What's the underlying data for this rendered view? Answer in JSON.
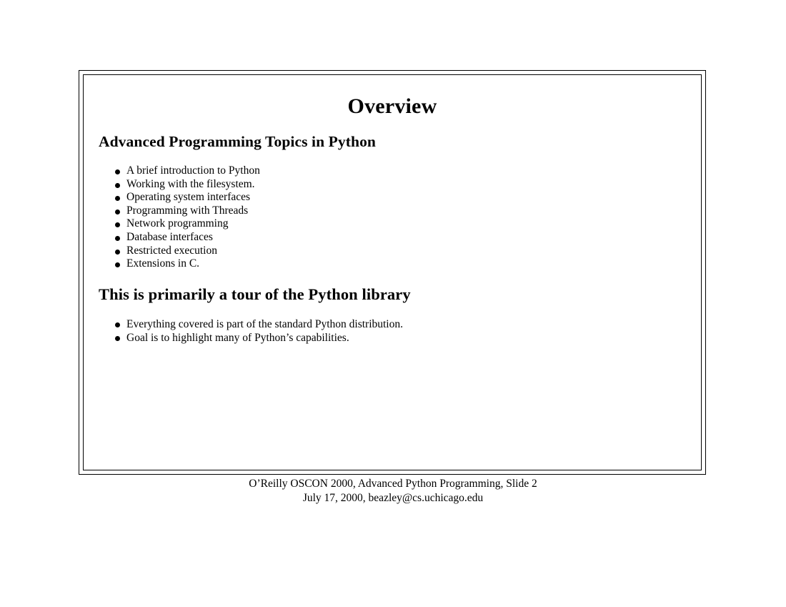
{
  "slide": {
    "title": "Overview",
    "sections": [
      {
        "heading": "Advanced Programming Topics in Python",
        "bullets": [
          "A brief introduction to Python",
          "Working with the filesystem.",
          "Operating system interfaces",
          "Programming with Threads",
          "Network programming",
          "Database interfaces",
          "Restricted execution",
          "Extensions in C."
        ]
      },
      {
        "heading": "This is primarily a tour of the Python library",
        "bullets": [
          "Everything covered is part of the standard Python distribution.",
          "Goal is to highlight many of Python’s capabilities."
        ]
      }
    ],
    "bullet_glyph": "filled-circle-bullet"
  },
  "footer": {
    "line1": "O’Reilly OSCON 2000, Advanced Python Programming, Slide 2",
    "line2": "July 17, 2000, beazley@cs.uchicago.edu"
  },
  "colors": {
    "page_background": "#ffffff",
    "text": "#000000",
    "border": "#000000"
  }
}
